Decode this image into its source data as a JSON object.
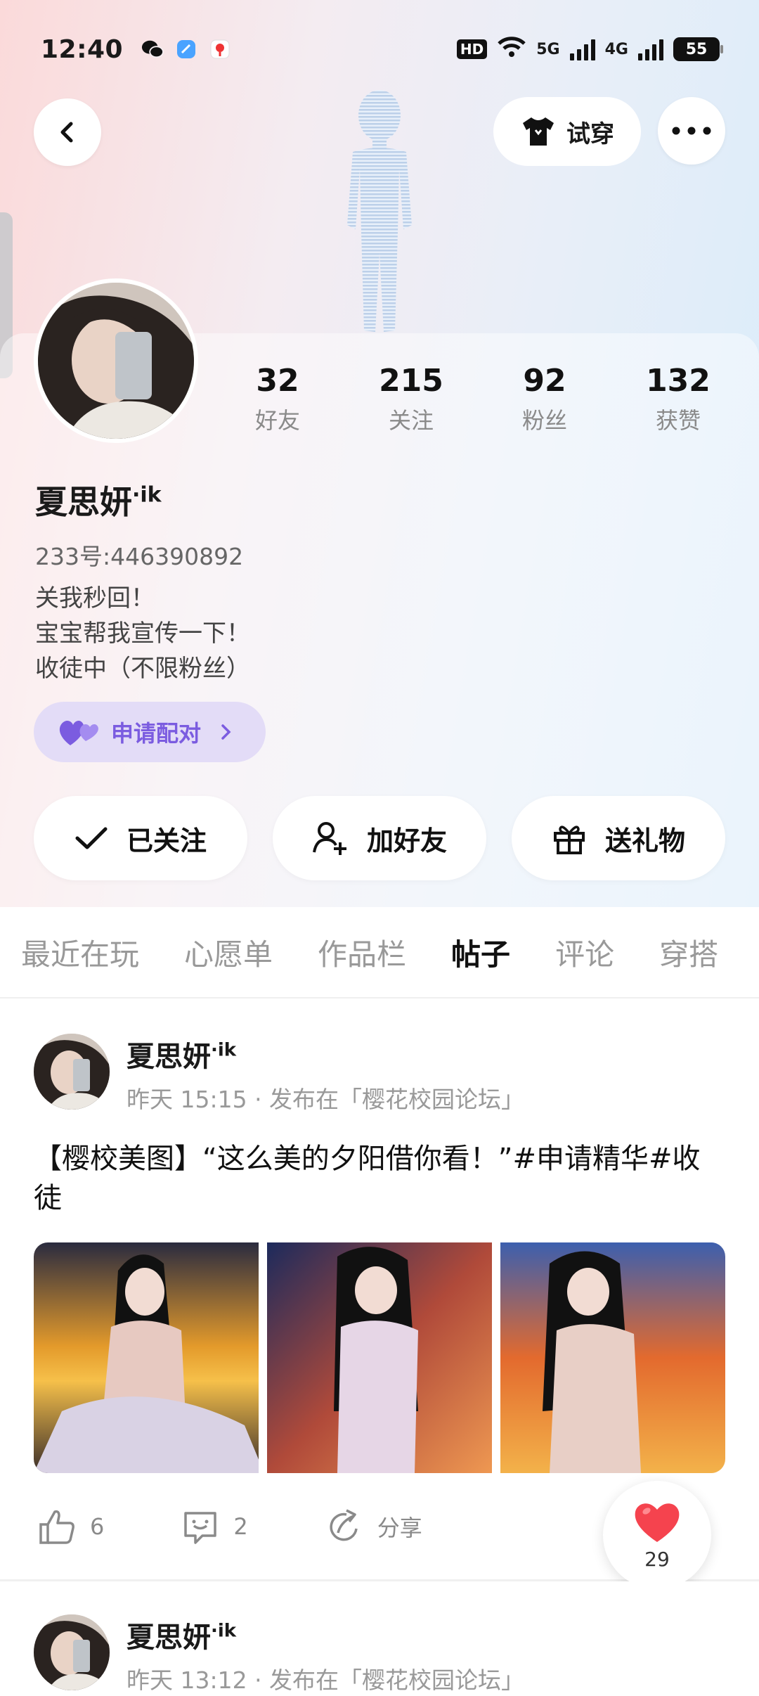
{
  "status_bar": {
    "time": "12:40",
    "hd_label": "HD",
    "sim1_label": "5G",
    "sim2_label": "4G",
    "battery": "55"
  },
  "header": {
    "try_on_label": "试穿"
  },
  "profile": {
    "username": "夏思妍",
    "username_suffix": "·ik",
    "uid": "233号:446390892",
    "bio": [
      "关我秒回！",
      "宝宝帮我宣传一下！",
      "收徒中（不限粉丝）"
    ],
    "pair_label": "申请配对",
    "stats": [
      {
        "value": "32",
        "label": "好友"
      },
      {
        "value": "215",
        "label": "关注"
      },
      {
        "value": "92",
        "label": "粉丝"
      },
      {
        "value": "132",
        "label": "获赞"
      }
    ]
  },
  "actions": {
    "follow_label": "已关注",
    "add_friend_label": "加好友",
    "gift_label": "送礼物"
  },
  "tabs": [
    "最近在玩",
    "心愿单",
    "作品栏",
    "帖子",
    "评论",
    "穿搭"
  ],
  "active_tab": "帖子",
  "posts": [
    {
      "author": "夏思妍",
      "author_suffix": "·ik",
      "meta": "昨天 15:15 · 发布在「樱花校园论坛」",
      "text": "【樱校美图】“这么美的夕阳借你看！”#申请精华#收徒",
      "likes": "6",
      "comments": "2",
      "share_label": "分享"
    },
    {
      "author": "夏思妍",
      "author_suffix": "·ik",
      "meta": "昨天 13:12 · 发布在「樱花校园论坛」"
    }
  ],
  "float_like_count": "29",
  "colors": {
    "accent_orange": "#f07a2a",
    "pair_purple": "#7b5ce0",
    "like_red": "#f5434e"
  }
}
